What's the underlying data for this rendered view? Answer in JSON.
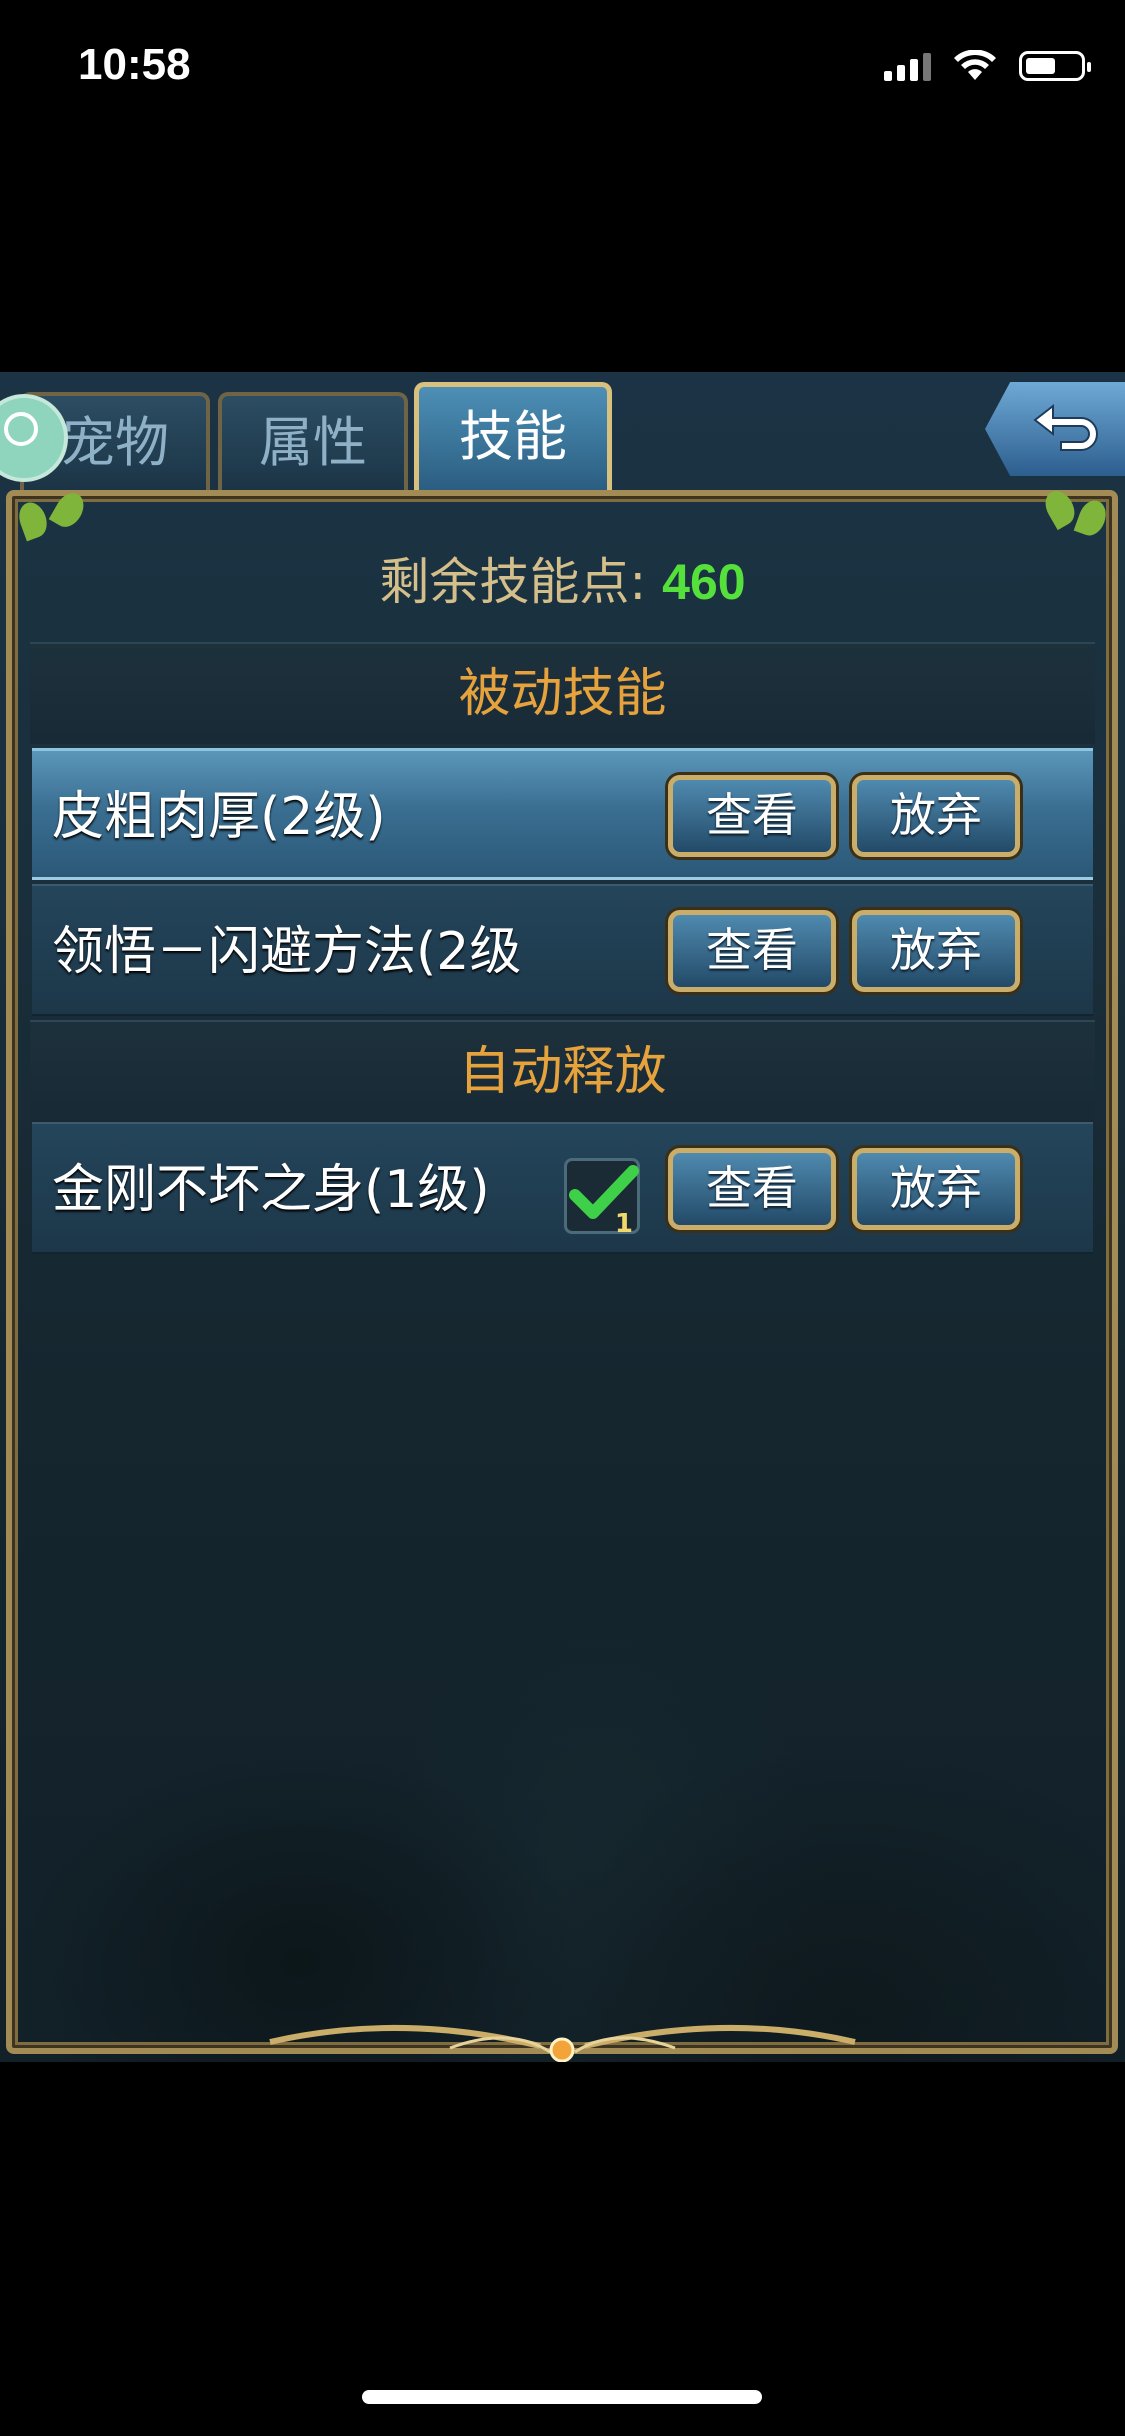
{
  "status_bar": {
    "time": "10:58"
  },
  "tabs": [
    {
      "label": "宠物"
    },
    {
      "label": "属性"
    },
    {
      "label": "技能"
    }
  ],
  "active_tab": "技能",
  "skill_points": {
    "label": "剩余技能点:",
    "value": "460"
  },
  "passive_section": {
    "title": "被动技能",
    "skills": [
      {
        "name": "皮粗肉厚(2级)",
        "view_label": "查看",
        "abandon_label": "放弃"
      },
      {
        "name": "领悟－闪避方法(2级",
        "view_label": "查看",
        "abandon_label": "放弃"
      }
    ]
  },
  "auto_section": {
    "title": "自动释放",
    "skills": [
      {
        "name": "金刚不坏之身(1级)",
        "auto_checked": true,
        "auto_count": "1",
        "view_label": "查看",
        "abandon_label": "放弃"
      }
    ]
  },
  "colors": {
    "accent_gold": "#e6a23c",
    "points_green": "#55e03c",
    "frame_gold": "#a28b54"
  }
}
